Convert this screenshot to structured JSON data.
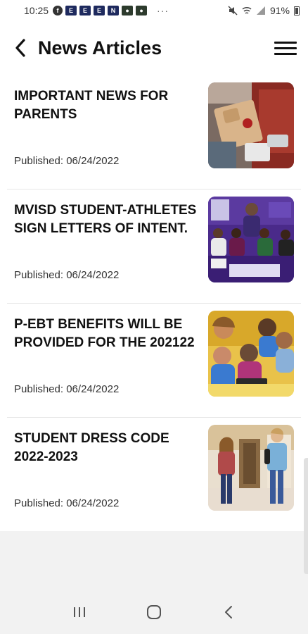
{
  "status_bar": {
    "time": "10:25",
    "battery": "91%",
    "notification_icons": [
      "facebook-icon",
      "app-notification-icon",
      "app-notification-icon",
      "app-notification-icon",
      "app-notification-icon",
      "app-notification-icon",
      "app-notification-icon"
    ],
    "more": "···"
  },
  "app_bar": {
    "title": "News Articles",
    "back_icon": "chevron-left-icon",
    "menu_icon": "hamburger-menu-icon"
  },
  "articles": [
    {
      "title": "IMPORTANT NEWS FOR PARENTS",
      "date": "Published: 06/24/2022",
      "image": "cafeteria-tray-photo"
    },
    {
      "title": "MVISD STUDENT-ATHLETES SIGN LETTERS OF INTENT.",
      "date": "Published: 06/24/2022",
      "image": "athletes-signing-photo"
    },
    {
      "title": "P-EBT BENEFITS WILL BE PROVIDED FOR THE 202122",
      "date": "Published: 06/24/2022",
      "image": "students-tablet-photo"
    },
    {
      "title": "STUDENT DRESS CODE 2022-2023",
      "date": "Published: 06/24/2022",
      "image": "students-hallway-photo"
    }
  ],
  "nav_bar": {
    "recents_icon": "recent-apps-icon",
    "home_icon": "home-icon",
    "back_icon": "back-icon"
  },
  "colors": {
    "background": "#f2f2f2",
    "surface": "#ffffff",
    "text": "#111111",
    "divider": "#e6e6e6"
  }
}
